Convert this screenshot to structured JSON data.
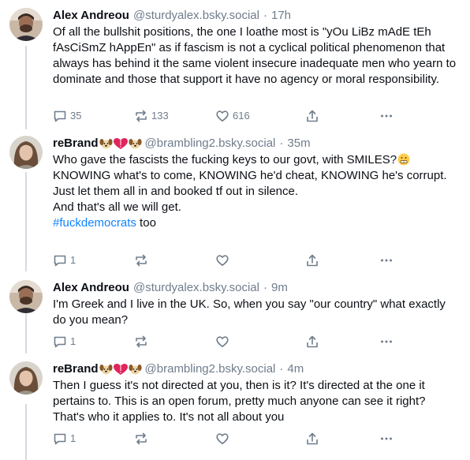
{
  "colors": {
    "text": "#0b0f14",
    "muted": "#6f7d8c",
    "link": "#1083fe",
    "thread_line": "#d4dbe2"
  },
  "posts": [
    {
      "author": "Alex Andreou",
      "author_emoji": "",
      "handle": "@sturdyalex.bsky.social",
      "separator": "·",
      "time": "17h",
      "avatar_icon": "man-portrait-avatar",
      "text": [
        "Of all the bullshit positions, the one I loathe most is \"yOu LiBz mAdE tEh fAsCiSmZ hAppEn\" as if fascism is not a cyclical political phenomenon that always has behind it the same violent insecure inadequate men who yearn to dominate and those that support it have no agency or moral responsibility."
      ],
      "replies": "35",
      "reposts": "133",
      "likes": "616"
    },
    {
      "author": "reBrand",
      "author_emoji": "dog-face heart-exclamation dog-face",
      "handle": "@brambling2.bsky.social",
      "separator": "·",
      "time": "35m",
      "avatar_icon": "woman-portrait-avatar",
      "text": [
        "Who gave the fascists the fucking keys to our govt, with SMILES?",
        "KNOWING what's to come, KNOWING he'd cheat, KNOWING he's corrupt.",
        "Just let them all in and booked tf out in silence.",
        "And that's all we will get."
      ],
      "emoji_after_line_1": "grimacing-face-emoji",
      "hashtag": "#fuckdemocrats",
      "hashtag_suffix": " too",
      "replies": "1",
      "reposts": "",
      "likes": ""
    },
    {
      "author": "Alex Andreou",
      "author_emoji": "",
      "handle": "@sturdyalex.bsky.social",
      "separator": "·",
      "time": "9m",
      "avatar_icon": "man-portrait-avatar",
      "text": [
        "I'm Greek and I live in the UK. So, when you say \"our country\" what exactly do you mean?"
      ],
      "replies": "1",
      "reposts": "",
      "likes": ""
    },
    {
      "author": "reBrand",
      "author_emoji": "dog-face heart-exclamation dog-face",
      "handle": "@brambling2.bsky.social",
      "separator": "·",
      "time": "4m",
      "avatar_icon": "woman-portrait-avatar",
      "text": [
        "Then I guess it's not directed at you, then is it? It's directed at the one it pertains to. This is an open forum, pretty much anyone can see it right? That's who it applies to. It's not all about you"
      ],
      "replies": "1",
      "reposts": "",
      "likes": ""
    }
  ]
}
